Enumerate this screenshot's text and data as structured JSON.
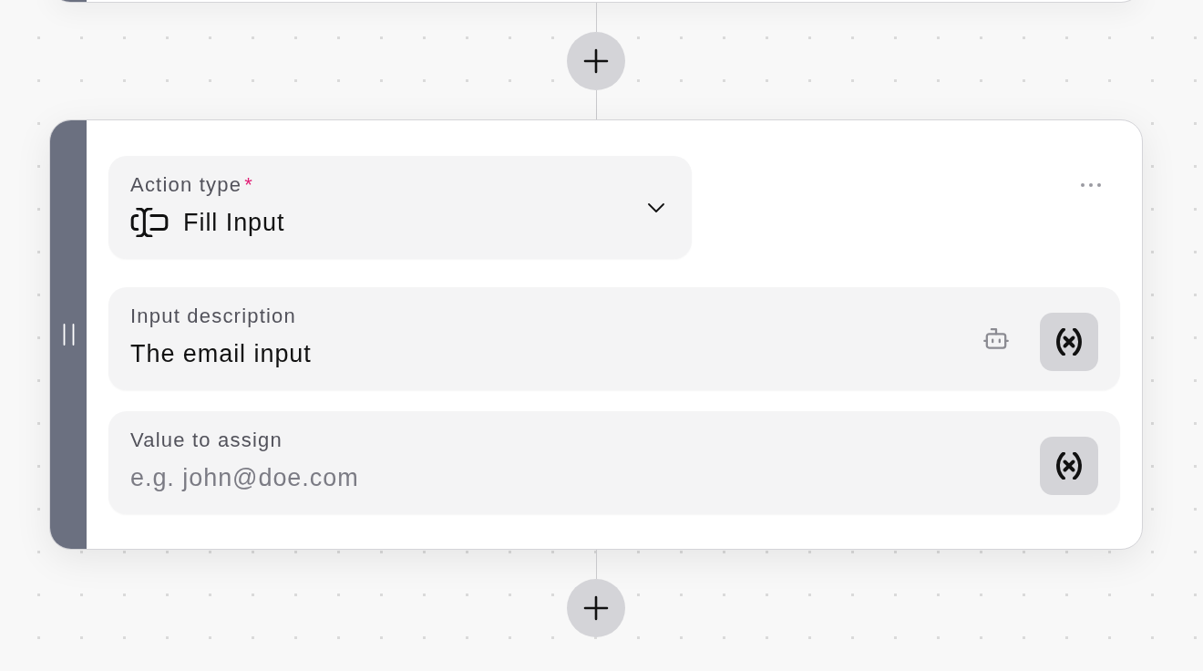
{
  "action_card": {
    "action_type": {
      "label": "Action type",
      "required_mark": "*",
      "value": "Fill Input"
    },
    "fields": [
      {
        "label": "Input description",
        "value": "The email input",
        "ai_button": true
      },
      {
        "label": "Value to assign",
        "placeholder": "e.g. john@doe.com",
        "ai_button": false
      }
    ]
  }
}
